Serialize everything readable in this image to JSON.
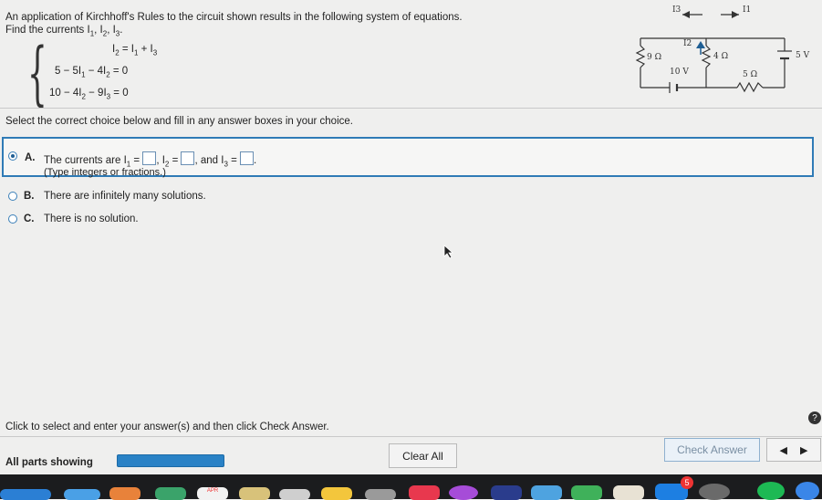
{
  "question": {
    "line1": "An application of Kirchhoff's Rules to the circuit shown results in the following system of equations.",
    "line2_prefix": "Find the currents I",
    "line2_sub1": "1",
    "line2_sep1": ", I",
    "line2_sub2": "2",
    "line2_sep2": ", I",
    "line2_sub3": "3",
    "line2_end": "."
  },
  "equations": [
    {
      "parts": [
        "I",
        "2",
        " = I",
        "1",
        " + I",
        "3",
        ""
      ]
    },
    {
      "parts": [
        "5 − 5I",
        "1",
        " − 4I",
        "2",
        " = 0",
        "",
        ""
      ]
    },
    {
      "parts": [
        "10 − 4I",
        "2",
        " − 9I",
        "3",
        " = 0",
        "",
        ""
      ]
    }
  ],
  "circuit": {
    "i3_label": "I3",
    "i1_label": "I1",
    "i2_label": "I2",
    "r1": "9 Ω",
    "r2": "4 Ω",
    "r3": "5 Ω",
    "v1": "10 V",
    "v2": "5 V"
  },
  "instruction": "Select the correct choice below and fill in any answer boxes in your choice.",
  "choices": {
    "a_letter": "A.",
    "a_t1": "The currents are I",
    "a_s1": "1",
    "a_t2": " = ",
    "a_t3": ", I",
    "a_s2": "2",
    "a_t4": " = ",
    "a_t5": ", and I",
    "a_s3": "3",
    "a_t6": " = ",
    "a_t7": ".",
    "a_hint": "(Type integers or fractions.)",
    "b_letter": "B.",
    "b_text": "There are infinitely many solutions.",
    "c_letter": "C.",
    "c_text": "There is no solution."
  },
  "footer": {
    "instruction": "Click to select and enter your answer(s) and then click Check Answer.",
    "help": "?",
    "parts_label": "All parts showing",
    "progress": 1.0,
    "clear_all": "Clear All",
    "check_answer": "Check Answer"
  },
  "dock": {
    "calendar_month": "APR",
    "appstore_badge": "5"
  }
}
